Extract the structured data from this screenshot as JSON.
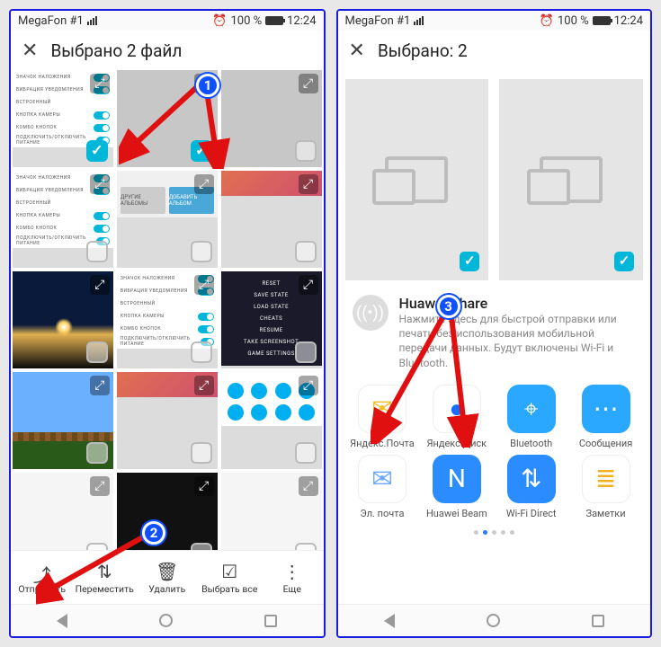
{
  "statusbar": {
    "carrier": "MegaFon #1",
    "battery_pct": "100 %",
    "time": "12:24"
  },
  "left": {
    "title": "Выбрано 2 файл",
    "thumbs": [
      {
        "text_rows": [
          "ЗНАЧОК НАЛОЖЕНИЯ",
          "ВИБРАЦИЯ УВЕДОМЛЕНИЯ",
          "ВСТРОЕННЫЙ",
          "КНОПКА КАМЕРЫ",
          "КОМБО КНОПОК",
          "ПОДКЛЮЧИТЬ/ОТКЛЮЧИТЬ ПИТАНИЕ"
        ]
      },
      {},
      {},
      {},
      {},
      {},
      {},
      {},
      {
        "menu": [
          "RESET",
          "SAVE STATE",
          "LOAD STATE",
          "CHEATS",
          "RESUME",
          "TAKE SCREENSHOT",
          "GAME SETTINGS"
        ]
      },
      {},
      {},
      {},
      {},
      {},
      {}
    ],
    "folders": {
      "other": "ДРУГИЕ АЛЬБОМЫ",
      "add": "ДОБАВИТЬ АЛЬБОМ"
    },
    "bottom": {
      "send": "Отправить",
      "move": "Переместить",
      "delete": "Удалить",
      "select_all": "Выбрать все",
      "more": "Еще"
    }
  },
  "right": {
    "title": "Выбрано: 2",
    "huawei": {
      "name": "Huawei Share",
      "desc": "Нажмите здесь для быстрой отправки или печати без использования мобильной передачи данных. Будут включены Wi-Fi и Bluetooth."
    },
    "apps": [
      {
        "label": "Яндекс.Почта",
        "bg": "#ffffff",
        "glyph": "✉",
        "glyphColor": "#f0c020",
        "border": "#eee"
      },
      {
        "label": "Яндекс.Диск",
        "bg": "#ffffff",
        "glyph": "●",
        "glyphColor": "#1a6cff",
        "border": "#eee"
      },
      {
        "label": "Bluetooth",
        "bg": "#2aa8ff",
        "glyph": "⌖",
        "glyphColor": "#fff"
      },
      {
        "label": "Сообщения",
        "bg": "#2aa8ff",
        "glyph": "⋯",
        "glyphColor": "#fff"
      },
      {
        "label": "Эл. почта",
        "bg": "#ffffff",
        "glyph": "✉",
        "glyphColor": "#6aa8ff",
        "border": "#eee"
      },
      {
        "label": "Huawei Beam",
        "bg": "#2a8cff",
        "glyph": "N",
        "glyphColor": "#fff"
      },
      {
        "label": "Wi-Fi Direct",
        "bg": "#2a8cff",
        "glyph": "⇅",
        "glyphColor": "#fff"
      },
      {
        "label": "Заметки",
        "bg": "#ffffff",
        "glyph": "≣",
        "glyphColor": "#f0b020",
        "border": "#eee"
      }
    ],
    "pager_count": 5,
    "pager_active": 1
  },
  "callouts": {
    "one": "1",
    "two": "2",
    "three": "3"
  }
}
